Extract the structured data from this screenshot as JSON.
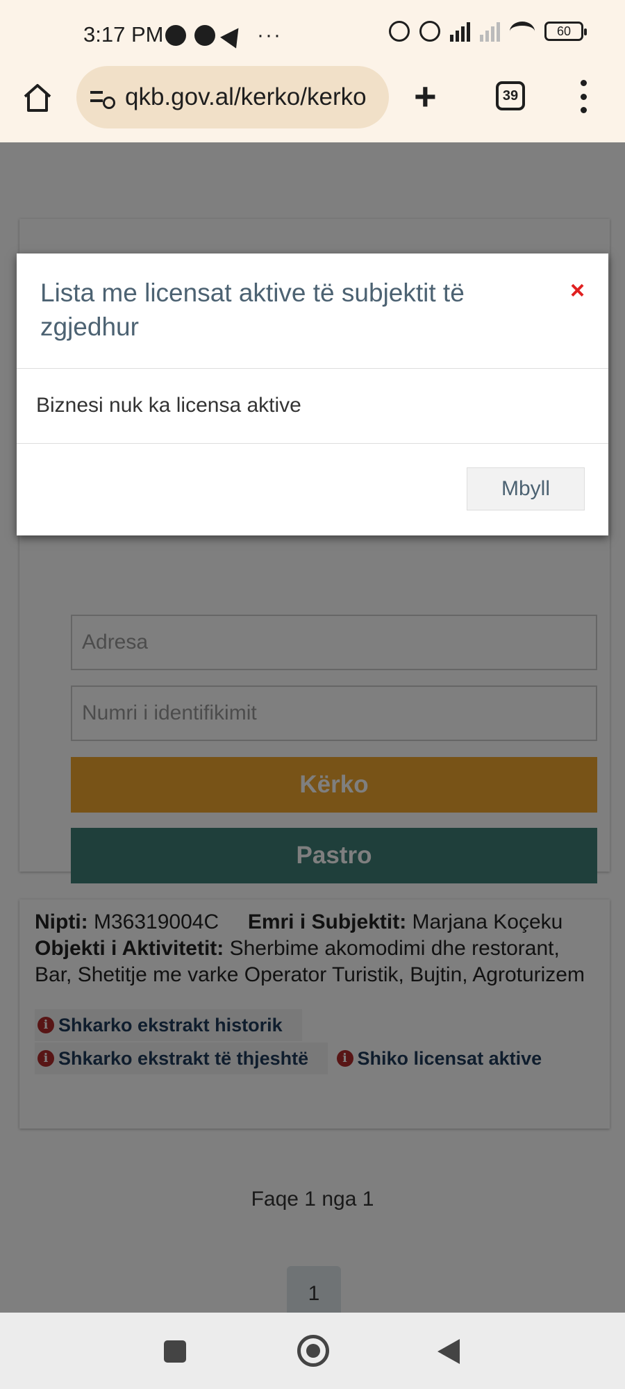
{
  "status_bar": {
    "time": "3:17 PM",
    "battery": "60",
    "overflow": "···"
  },
  "browser": {
    "url": "qkb.gov.al/kerko/kerko",
    "tab_count": "39",
    "new_tab": "+"
  },
  "search_form": {
    "address_placeholder": "Adresa",
    "id_placeholder": "Numri i identifikimit",
    "search_button": "Kërko",
    "clear_button": "Pastro"
  },
  "result": {
    "nipt_label": "Nipti:",
    "nipt_value": "M36319004C",
    "name_label": "Emri i Subjektit:",
    "name_value": "Marjana Koçeku",
    "activity_label": "Objekti i Aktivitetit:",
    "activity_value": "Sherbime akomodimi dhe restorant, Bar, Shetitje me varke Operator Turistik, Bujtin, Agroturizem",
    "links": {
      "historic": "Shkarko ekstrakt historik",
      "simple": "Shkarko ekstrakt të thjeshtë",
      "licenses": "Shiko licensat aktive"
    }
  },
  "pagination": {
    "info": "Faqe 1 nga 1",
    "current_page": "1"
  },
  "modal": {
    "title": "Lista me licensat aktive të subjektit të zgjedhur",
    "close_icon": "×",
    "body": "Biznesi nuk ka licensa aktive",
    "close_button": "Mbyll"
  },
  "colors": {
    "search_button": "#f0a72e",
    "clear_button": "#3f7f77",
    "close_x": "#e02020"
  }
}
